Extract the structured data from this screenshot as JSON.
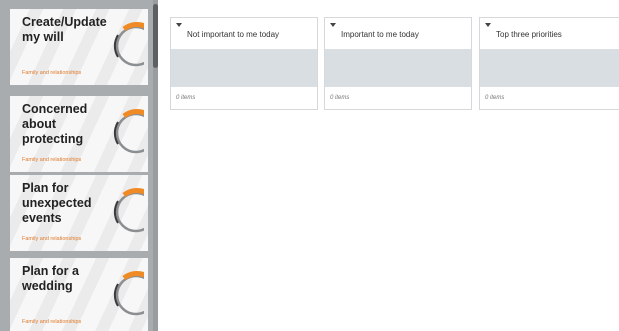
{
  "cards": [
    {
      "title": "Create/Update my will",
      "category": "Family and relationships"
    },
    {
      "title": "Concerned about protecting",
      "category": "Family and relationships"
    },
    {
      "title": "Plan for unexpected events",
      "category": "Family and relationships"
    },
    {
      "title": "Plan for a wedding",
      "category": "Family and relationships"
    }
  ],
  "columns": [
    {
      "label": "Not important to me today",
      "count": "0 items"
    },
    {
      "label": "Important to me today",
      "count": "0 items"
    },
    {
      "label": "Top three priorities",
      "count": "0 items"
    }
  ],
  "colors": {
    "accent": "#f08a24",
    "ring": "#8c8f92",
    "panel": "#a9acae",
    "drop_zone": "#d9dee2"
  },
  "icons": {
    "card_ring": "progress-ring-icon",
    "column_toggle": "caret-down-icon"
  }
}
